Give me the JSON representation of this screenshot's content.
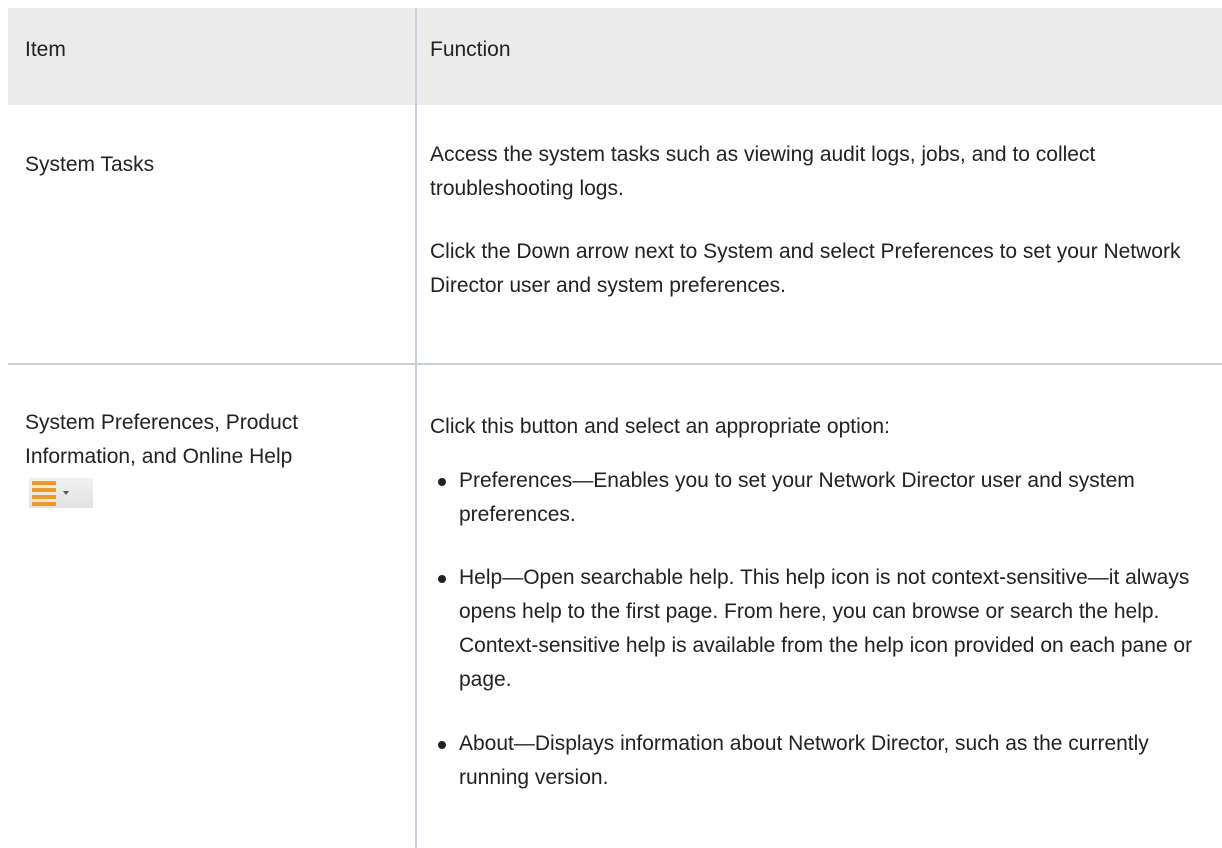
{
  "table": {
    "headers": {
      "item": "Item",
      "function": "Function"
    },
    "rows": [
      {
        "item": "System Tasks",
        "paragraphs": [
          "Access the system tasks such as viewing audit logs, jobs, and to collect troubleshooting logs.",
          "Click the Down arrow next to System and select Preferences to set your Network Director user and system preferences."
        ]
      },
      {
        "item": "System Preferences, Product Information, and Online Help",
        "icon": "menu-dropdown-icon",
        "intro": "Click this button and select an appropriate option:",
        "bullets": [
          "Preferences—Enables you to set your Network Director user and system preferences.",
          "Help—Open searchable help. This help icon is not context-sensitive—it always opens help to the first page. From here, you can browse or search the help. Context-sensitive help is available from the help icon provided on each pane or page.",
          "About—Displays information about Network Director, such as the currently running version."
        ]
      }
    ]
  },
  "colors": {
    "header_bg": "#ebebeb",
    "divider": "#c7d0d9",
    "text": "#222222",
    "icon_orange": "#f29a1d"
  }
}
